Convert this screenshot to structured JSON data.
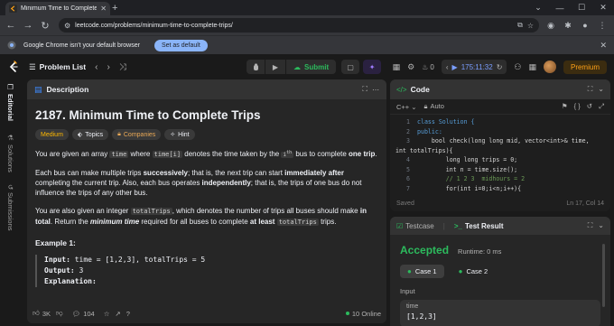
{
  "browser": {
    "tab_title": "Minimum Time to Complete Trips",
    "url": "leetcode.com/problems/minimum-time-to-complete-trips/",
    "infobar_message": "Google Chrome isn't your default browser",
    "infobar_button": "Set as default"
  },
  "header": {
    "problem_list": "Problem List",
    "submit": "Submit",
    "streak": "0",
    "timer": "175:11:32",
    "premium": "Premium"
  },
  "side_tabs": [
    "Editorial",
    "Solutions",
    "Submissions"
  ],
  "description": {
    "tab_label": "Description",
    "title": "2187. Minimum Time to Complete Trips",
    "tags": {
      "difficulty": "Medium",
      "topics": "Topics",
      "companies": "Companies",
      "hint": "Hint"
    },
    "p1": {
      "a": "You are given an array ",
      "code1": "time",
      "b": " where ",
      "code2": "time[i]",
      "c": " denotes the time taken by the ",
      "sup_i": "i",
      "sup": "th",
      "d": " bus to complete ",
      "bold": "one trip",
      "e": "."
    },
    "p2": {
      "a": "Each bus can make multiple trips ",
      "b1": "successively",
      "b": "; that is, the next trip can start ",
      "b2": "immediately after",
      "c": " completing the current trip. Also, each bus operates ",
      "b3": "independently",
      "d": "; that is, the trips of one bus do not influence the trips of any other bus."
    },
    "p3": {
      "a": "You are also given an integer ",
      "code1": "totalTrips",
      "b": ", which denotes the number of trips all buses should make ",
      "b1": "in total",
      "c": ". Return the ",
      "bi": "minimum time",
      "d": " required for all buses to complete ",
      "b2": "at least",
      "e": " ",
      "code2": "totalTrips",
      "f": " trips."
    },
    "example_title": "Example 1:",
    "example": {
      "input_label": "Input:",
      "input_value": " time = [1,2,3], totalTrips = 5",
      "output_label": "Output:",
      "output_value": " 3",
      "explanation_label": "Explanation:"
    },
    "footer": {
      "likes": "3K",
      "comments": "104",
      "online": "10 Online"
    }
  },
  "code": {
    "tab_label": "Code",
    "language": "C++",
    "mode": "Auto",
    "lines": [
      {
        "n": "1",
        "t": "class Solution {"
      },
      {
        "n": "2",
        "t": "public:"
      },
      {
        "n": "3",
        "t": "    bool check(long long mid, vector<int>& time,"
      },
      {
        "n": "",
        "t": "int totalTrips){"
      },
      {
        "n": "4",
        "t": "        long long trips = 0;"
      },
      {
        "n": "5",
        "t": "        int n = time.size();"
      },
      {
        "n": "6",
        "t": "        // 1 2 3  midhours = 2"
      },
      {
        "n": "7",
        "t": "        for(int i=0;i<n;i++){"
      }
    ],
    "status_saved": "Saved",
    "status_pos": "Ln 17, Col 14"
  },
  "testcase": {
    "tab_testcase": "Testcase",
    "tab_result": "Test Result",
    "accepted": "Accepted",
    "runtime": "Runtime: 0 ms",
    "case1": "Case 1",
    "case2": "Case 2",
    "input_label": "Input",
    "var_name": "time",
    "var_value": "[1,2,3]"
  },
  "colors": {
    "accent_orange": "#ffa116",
    "accepted_green": "#2cbb5d",
    "medium_yellow": "#ffb800",
    "timer_blue": "#7a9eff"
  }
}
